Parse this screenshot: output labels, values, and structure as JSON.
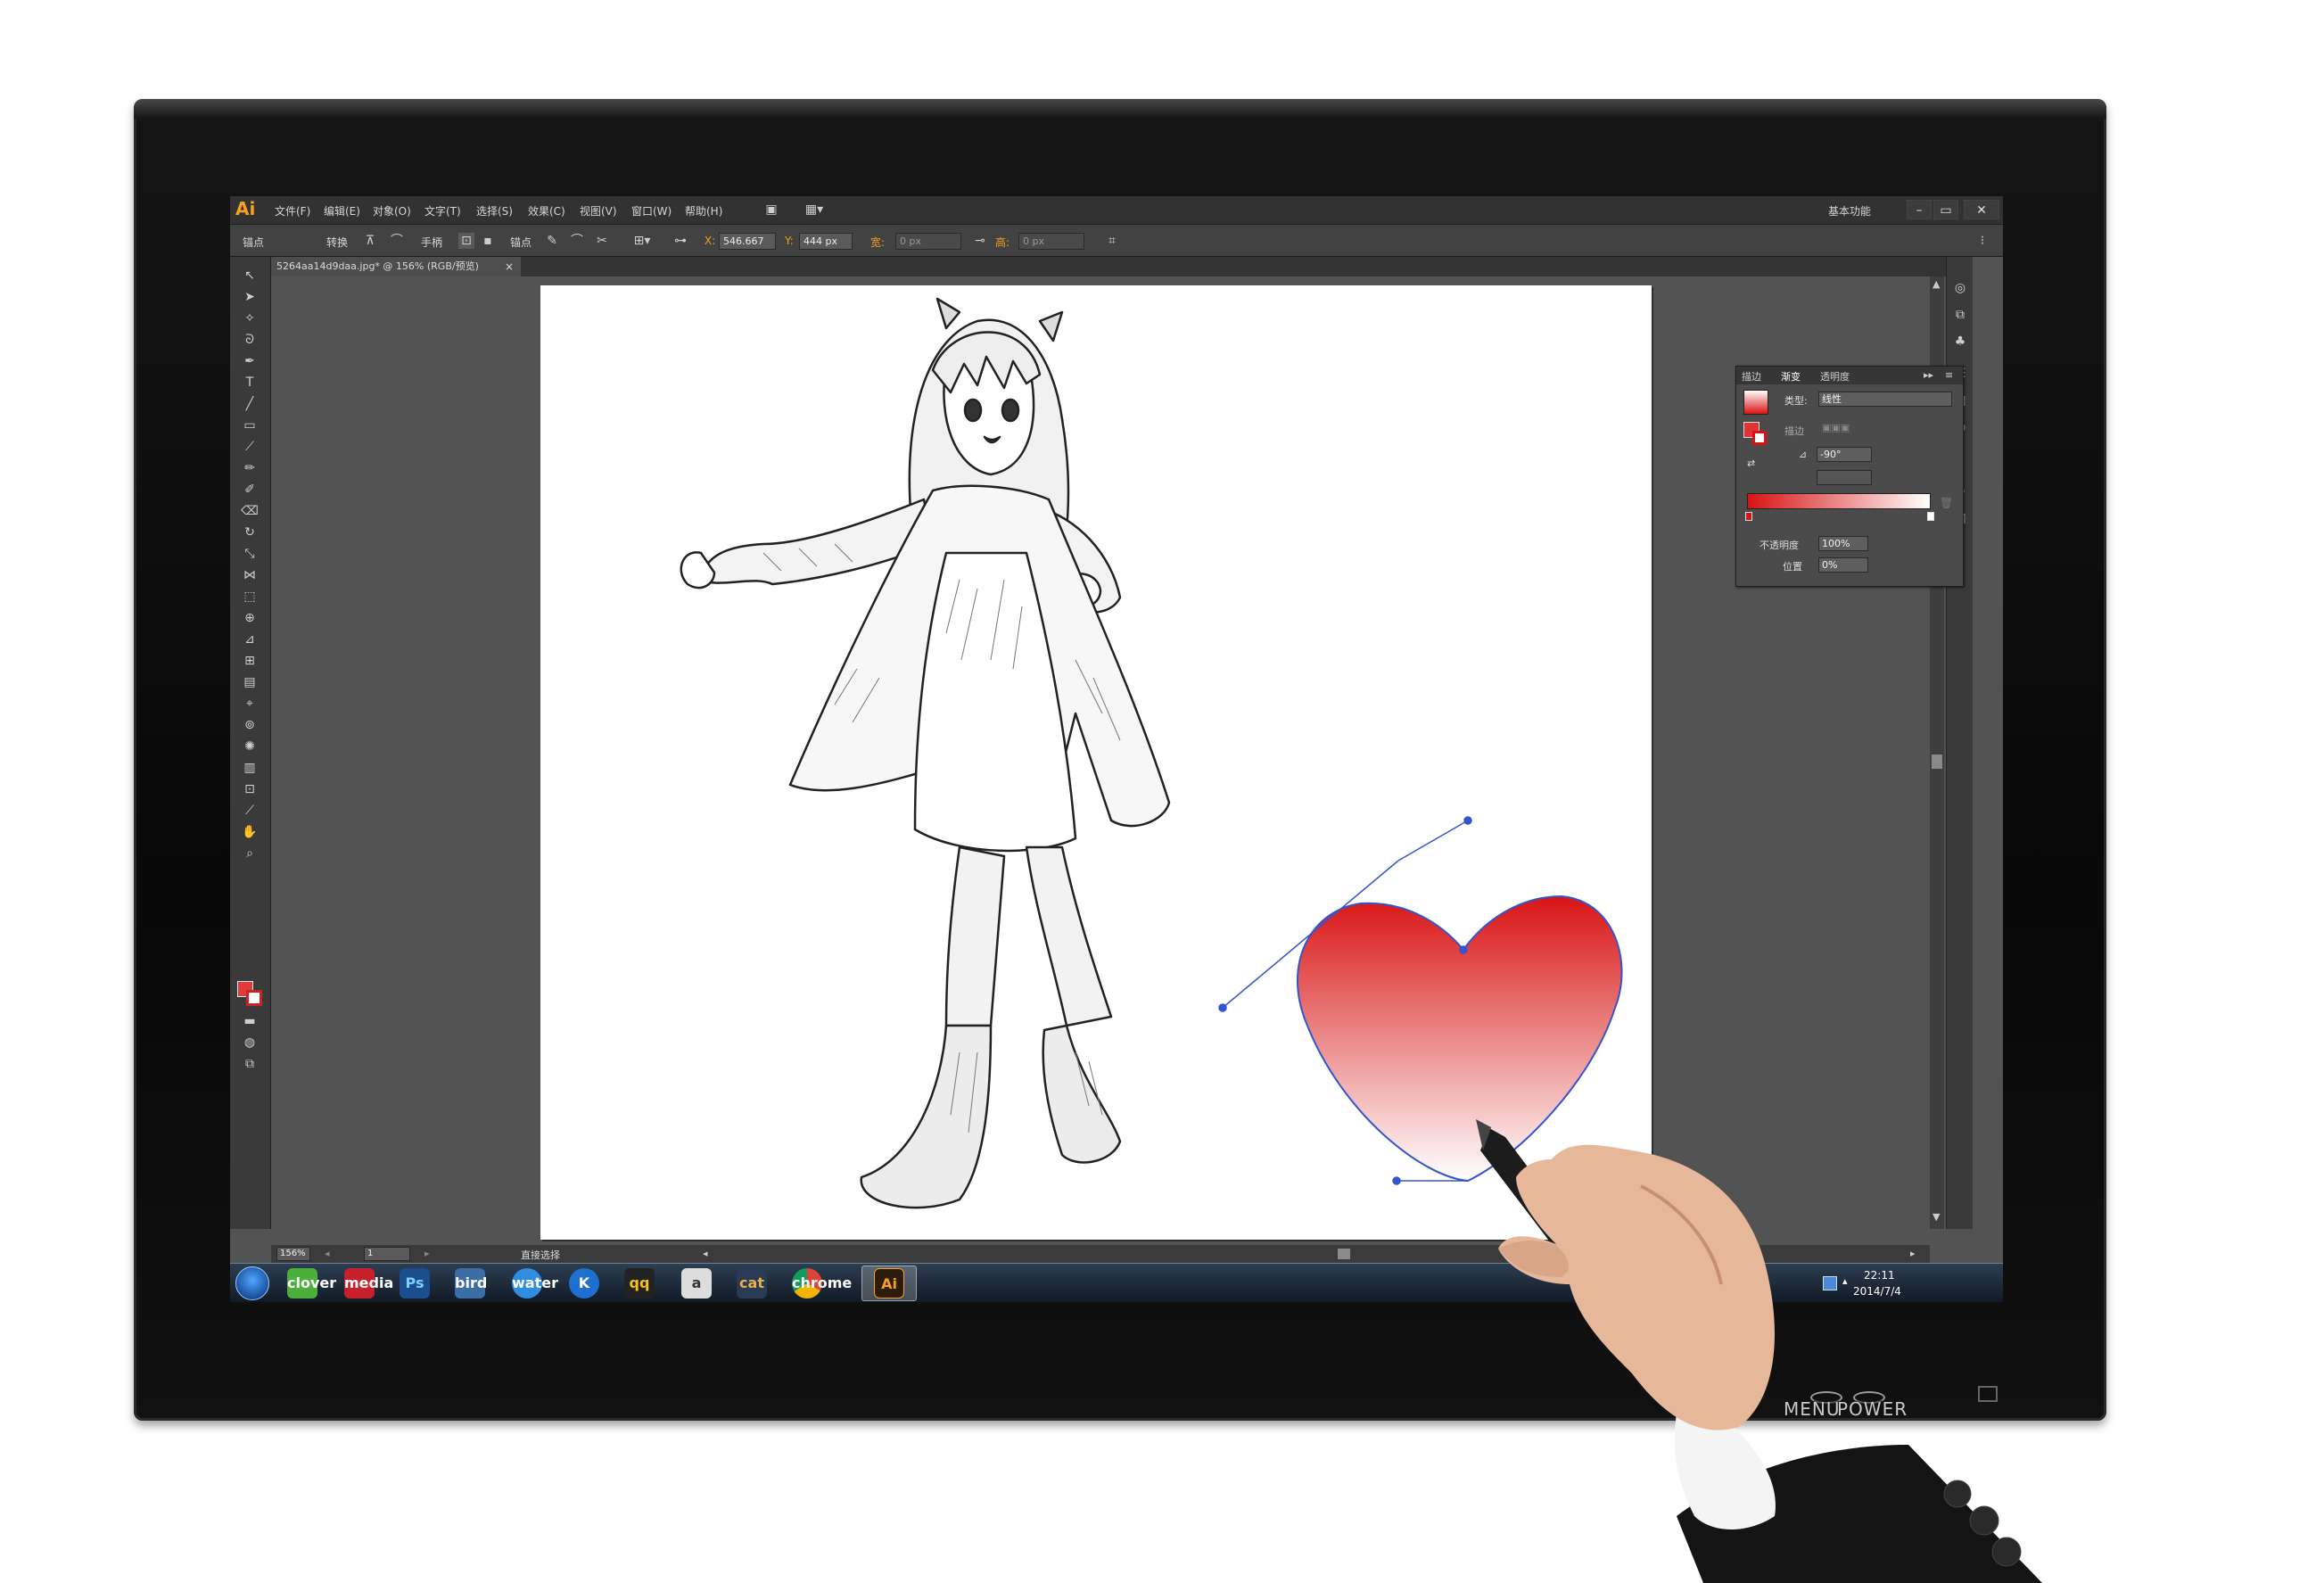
{
  "app": {
    "logo": "Ai",
    "menu": [
      "文件(F)",
      "编辑(E)",
      "对象(O)",
      "文字(T)",
      "选择(S)",
      "效果(C)",
      "视图(V)",
      "窗口(W)",
      "帮助(H)"
    ],
    "workspace_label": "基本功能",
    "window_buttons": [
      "–",
      "▭",
      "✕"
    ]
  },
  "control_bar": {
    "anchor_label": "锚点",
    "convert_label": "转换",
    "handle_label": "手柄",
    "anchors_label": "锚点",
    "x_label": "X:",
    "x_value": "546.667",
    "y_label": "Y:",
    "y_value": "444 px",
    "w_label": "宽:",
    "w_value": "0 px",
    "h_label": "高:",
    "h_value": "0 px"
  },
  "document": {
    "tab_title": "5264aa14d9daa.jpg* @ 156% (RGB/预览)",
    "close_glyph": "×"
  },
  "gradient_panel": {
    "tabs": [
      "描边",
      "渐变",
      "透明度"
    ],
    "type_label": "类型:",
    "type_value": "线性",
    "stroke_label": "描边",
    "angle_value": "-90°",
    "opacity_label": "不透明度",
    "opacity_value": "100%",
    "location_label": "位置",
    "location_value": "0%",
    "ramp_start_color": "#d91414",
    "ramp_end_color": "#ffffff"
  },
  "status_bar": {
    "zoom_value": "156%",
    "artboard_value": "1",
    "tool_mode": "直接选择"
  },
  "taskbar": {
    "apps": [
      "clover",
      "media",
      "Ps",
      "bird",
      "water",
      "K",
      "qq",
      "a",
      "cat",
      "chrome",
      "Ai"
    ],
    "clock_time": "22:11",
    "clock_date": "2014/7/4"
  },
  "monitor": {
    "menu_label": "MENU",
    "power_label": "POWER"
  },
  "canvas": {
    "heart_top_color": "#d91414",
    "heart_bottom_color": "#ffffff",
    "path_color": "#3355cc"
  }
}
